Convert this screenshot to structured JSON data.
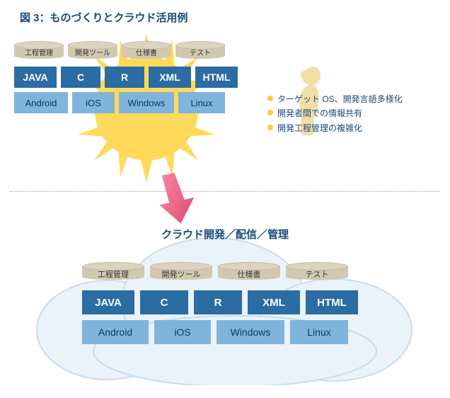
{
  "title": "図 3：ものづくりとクラウド活用例",
  "cloud_title": "クラウド開発／配信／管理",
  "bullets": [
    "ターゲット OS、開発言語多様化",
    "開発者間での情報共有",
    "開発工程管理の複雑化"
  ],
  "upper": {
    "cylinders": [
      "工程管理",
      "開発ツール",
      "仕様書",
      "テスト"
    ],
    "langs": [
      "JAVA",
      "C",
      "R",
      "XML",
      "HTML"
    ],
    "os": [
      "Android",
      "iOS",
      "Windows",
      "Linux"
    ]
  },
  "lower": {
    "cylinders": [
      "工程管理",
      "開発ツール",
      "仕様書",
      "テスト"
    ],
    "langs": [
      "JAVA",
      "C",
      "R",
      "XML",
      "HTML"
    ],
    "os": [
      "Android",
      "iOS",
      "Windows",
      "Linux"
    ]
  }
}
